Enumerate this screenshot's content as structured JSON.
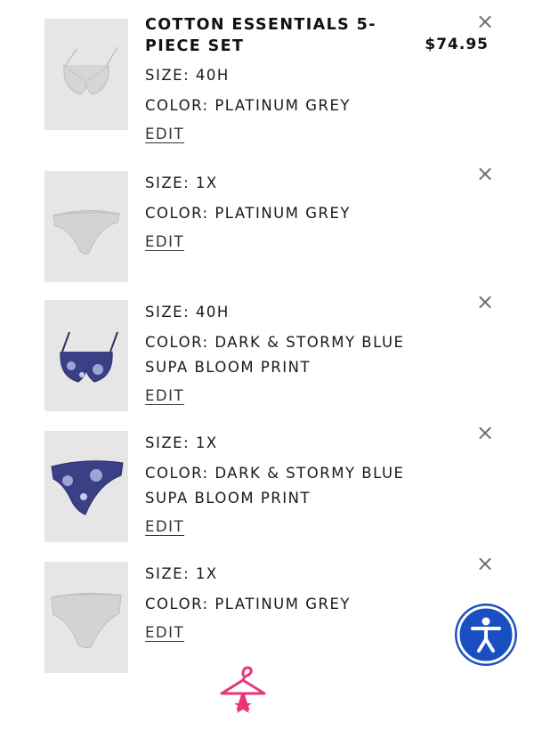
{
  "cart": {
    "items": [
      {
        "title": "COTTON ESSENTIALS 5-PIECE SET",
        "price": "$74.95",
        "size": "SIZE: 40H",
        "color": "COLOR: PLATINUM GREY",
        "edit_label": "EDIT",
        "remove_label": "×",
        "thumb_color": "#e6e6e6"
      },
      {
        "size": "SIZE: 1X",
        "color": "COLOR: PLATINUM GREY",
        "edit_label": "EDIT",
        "remove_label": "×"
      },
      {
        "size": "SIZE: 40H",
        "color": "COLOR: DARK & STORMY BLUE SUPA BLOOM PRINT",
        "edit_label": "EDIT",
        "remove_label": "×"
      },
      {
        "size": "SIZE: 1X",
        "color": "COLOR: DARK & STORMY BLUE SUPA BLOOM PRINT",
        "edit_label": "EDIT",
        "remove_label": "×"
      },
      {
        "size": "SIZE: 1X",
        "color": "COLOR: PLATINUM GREY",
        "edit_label": "EDIT",
        "remove_label": "×"
      }
    ]
  },
  "accessibility_button": {
    "icon": "accessibility-icon",
    "color": "#1a4fc1"
  },
  "loading_logo": {
    "icon": "hanger-logo-icon",
    "color": "#e8357a"
  },
  "colors": {
    "grey_fabric": "#d3d3d3",
    "navy_print": "#3b3f86",
    "thumb_bg": "#e6e6e6"
  }
}
